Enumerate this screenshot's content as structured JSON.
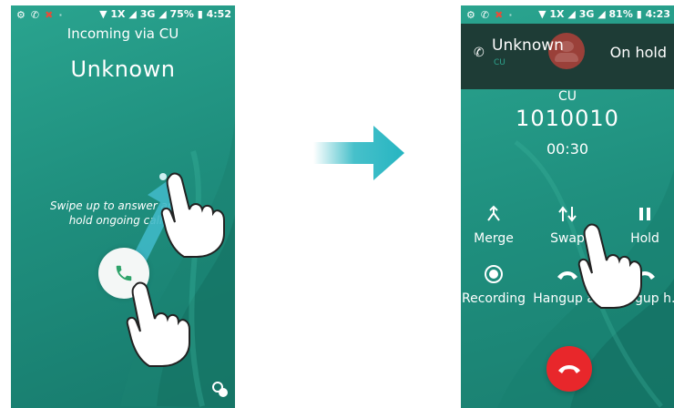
{
  "left_screen": {
    "status": {
      "network": "1X",
      "network2": "3G",
      "battery": "75%",
      "time": "4:52"
    },
    "title": "Incoming via CU",
    "caller": "Unknown",
    "swipe_hint": "Swipe up to answer and hold ongoing call",
    "icons": [
      "settings-icon",
      "phone-icon",
      "missed-call-icon",
      "phone-icon",
      "swap-call-icon"
    ]
  },
  "right_screen": {
    "status": {
      "network": "1X",
      "network2": "3G",
      "battery": "81%",
      "time": "4:23"
    },
    "held_caller": "Unknown",
    "held_carrier": "CU",
    "held_state": "On hold",
    "carrier": "CU",
    "number": "1010010",
    "timer": "00:30",
    "actions": [
      {
        "label": "Merge",
        "icon": "merge-icon"
      },
      {
        "label": "Swap",
        "icon": "swap-icon"
      },
      {
        "label": "Hold",
        "icon": "pause-icon"
      },
      {
        "label": "Recording",
        "icon": "record-icon"
      },
      {
        "label": "Hangup all",
        "icon": "hangup-all-icon"
      },
      {
        "label": "Hangup h...",
        "icon": "hangup-held-icon"
      }
    ]
  },
  "colors": {
    "screen": "#1f8f7e",
    "topbar": "#1e3c36",
    "arrow": "#26b5c1",
    "hangup": "#e8272b"
  }
}
